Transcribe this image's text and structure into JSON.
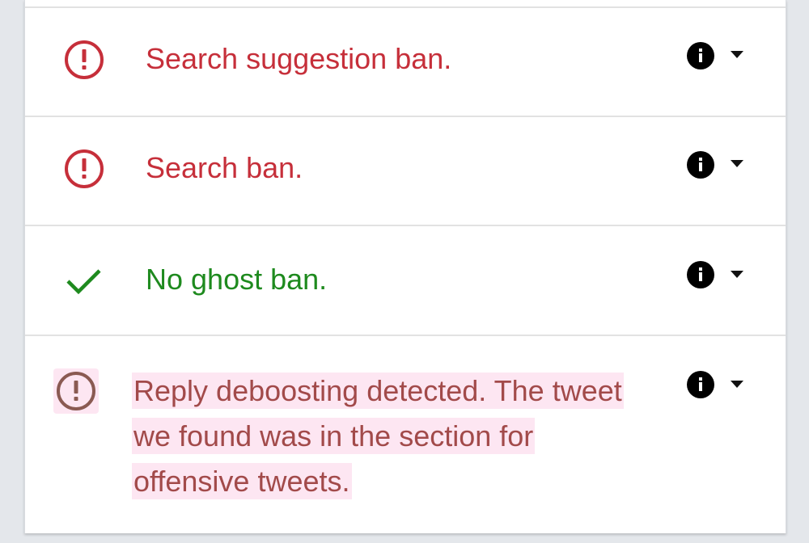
{
  "colors": {
    "fail": "#c62f3a",
    "pass": "#1e8a1e",
    "warn": "#a24a4a",
    "warn_highlight": "#fde6f2"
  },
  "results": [
    {
      "status": "fail",
      "icon": "exclamation-circle-icon",
      "message": "Search suggestion ban."
    },
    {
      "status": "fail",
      "icon": "exclamation-circle-icon",
      "message": "Search ban."
    },
    {
      "status": "pass",
      "icon": "checkmark-icon",
      "message": "No ghost ban."
    },
    {
      "status": "warn",
      "icon": "exclamation-circle-icon",
      "message": "Reply deboosting detected. The tweet we found was in the section for offensive tweets."
    }
  ],
  "row_controls": {
    "info_icon": "info-icon",
    "expand_icon": "caret-down-icon"
  }
}
